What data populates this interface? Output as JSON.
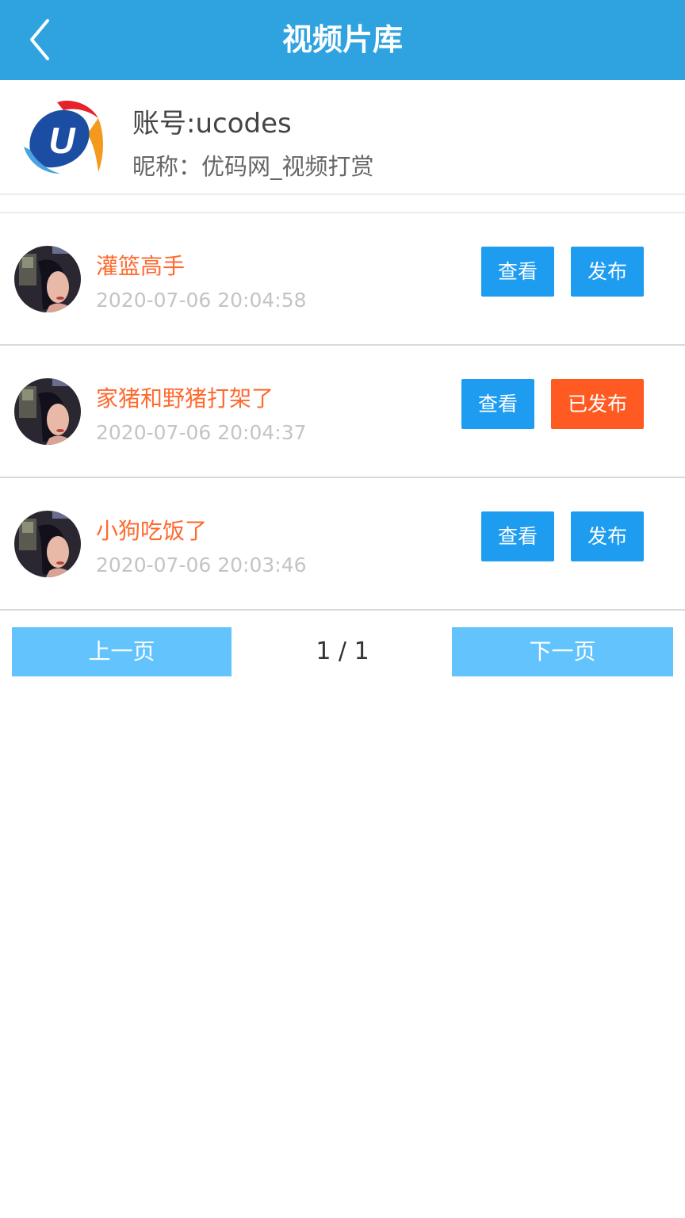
{
  "header": {
    "title": "视频片库"
  },
  "account": {
    "id_label": "账号:ucodes",
    "nickname_label": "昵称：优码网_视频打赏",
    "logo_letter": "U"
  },
  "videos": [
    {
      "title": "灌篮高手",
      "time": "2020-07-06 20:04:58",
      "view_label": "查看",
      "publish_label": "发布",
      "published": false
    },
    {
      "title": "家猪和野猪打架了",
      "time": "2020-07-06 20:04:37",
      "view_label": "查看",
      "publish_label": "已发布",
      "published": true
    },
    {
      "title": "小狗吃饭了",
      "time": "2020-07-06 20:03:46",
      "view_label": "查看",
      "publish_label": "发布",
      "published": false
    }
  ],
  "pager": {
    "prev_label": "上一页",
    "page_info": "1 / 1",
    "next_label": "下一页"
  },
  "colors": {
    "header": "#2ea3e0",
    "accent": "#1e9cf0",
    "published": "#ff5a22",
    "title": "#ff6a2f",
    "pager": "#62c3fd"
  }
}
